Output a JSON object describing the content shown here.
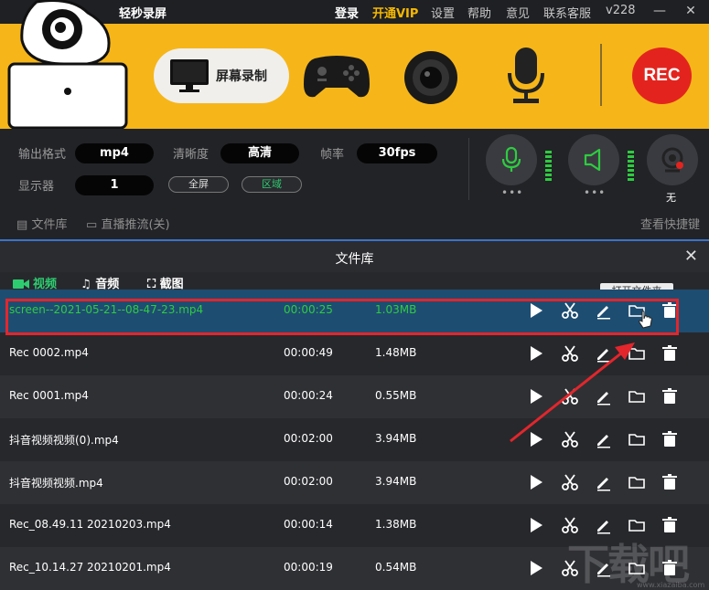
{
  "app": {
    "title": "轻秒录屏",
    "version": "v228"
  },
  "topnav": {
    "login": "登录",
    "vip": "开通VIP",
    "settings": "设置",
    "help": "帮助",
    "feedback": "意见",
    "support": "联系客服"
  },
  "toolbar": {
    "screen_record_label": "屏幕录制",
    "rec_label": "REC"
  },
  "settings": {
    "format_label": "输出格式",
    "format_value": "mp4",
    "quality_label": "清晰度",
    "quality_value": "高清",
    "fps_label": "帧率",
    "fps_value": "30fps",
    "display_label": "显示器",
    "display_value": "1",
    "fullscreen_label": "全屏",
    "region_label": "区域",
    "camera_none": "无"
  },
  "subnav": {
    "library": "文件库",
    "livestream": "直播推流(关)",
    "shortcuts": "查看快捷键"
  },
  "library": {
    "title": "文件库",
    "tabs": [
      "视频",
      "音频",
      "截图"
    ],
    "tooltip": "打开文件夹",
    "files": [
      {
        "name": "screen--2021-05-21--08-47-23.mp4",
        "duration": "00:00:25",
        "size": "1.03MB"
      },
      {
        "name": "Rec 0002.mp4",
        "duration": "00:00:49",
        "size": "1.48MB"
      },
      {
        "name": "Rec 0001.mp4",
        "duration": "00:00:24",
        "size": "0.55MB"
      },
      {
        "name": "抖音视频视频(0).mp4",
        "duration": "00:02:00",
        "size": "3.94MB"
      },
      {
        "name": "抖音视频视频.mp4",
        "duration": "00:02:00",
        "size": "3.94MB"
      },
      {
        "name": "Rec_08.49.11 20210203.mp4",
        "duration": "00:00:14",
        "size": "1.38MB"
      },
      {
        "name": "Rec_10.14.27 20210201.mp4",
        "duration": "00:00:19",
        "size": "0.54MB"
      }
    ]
  },
  "watermark": {
    "text": "下载吧",
    "url": "www.xiazaiba.com"
  },
  "colors": {
    "accent": "#f6b619",
    "rec": "#e3241e",
    "active_green": "#2ecc40",
    "selected_row": "#1e4d72"
  }
}
